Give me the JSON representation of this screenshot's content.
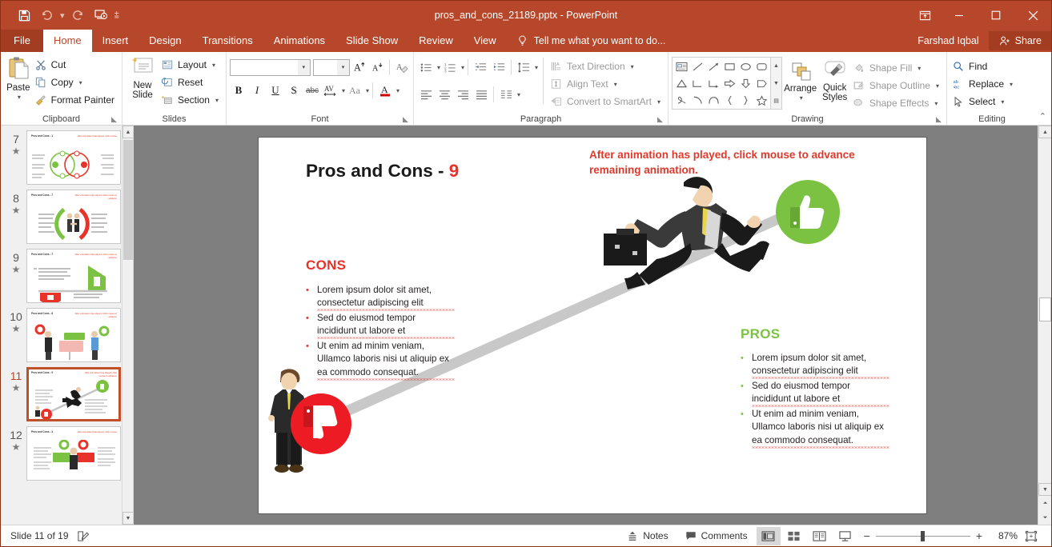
{
  "app": {
    "title": "pros_and_cons_21189.pptx - PowerPoint",
    "accent": "#b7472a"
  },
  "quick_access": {
    "save": "save-icon",
    "undo": "undo-icon",
    "redo": "redo-icon",
    "start_slideshow": "slideshow-icon",
    "customize": "customize-icon"
  },
  "window": {
    "ribbon_display": "ribbon-display-options",
    "minimize": "minimize",
    "maximize": "maximize",
    "close": "close"
  },
  "tabs": [
    {
      "label": "File",
      "active": false
    },
    {
      "label": "Home",
      "active": true
    },
    {
      "label": "Insert",
      "active": false
    },
    {
      "label": "Design",
      "active": false
    },
    {
      "label": "Transitions",
      "active": false
    },
    {
      "label": "Animations",
      "active": false
    },
    {
      "label": "Slide Show",
      "active": false
    },
    {
      "label": "Review",
      "active": false
    },
    {
      "label": "View",
      "active": false
    }
  ],
  "tellme": {
    "placeholder": "Tell me what you want to do..."
  },
  "account": {
    "user": "Farshad Iqbal",
    "share": "Share"
  },
  "ribbon": {
    "clipboard": {
      "label": "Clipboard",
      "paste": "Paste",
      "cut": "Cut",
      "copy": "Copy",
      "format_painter": "Format Painter"
    },
    "slides": {
      "label": "Slides",
      "new_slide": "New\nSlide",
      "new_slide_l1": "New",
      "new_slide_l2": "Slide",
      "layout": "Layout",
      "reset": "Reset",
      "section": "Section"
    },
    "font": {
      "label": "Font",
      "font_name": "",
      "font_name_placeholder": "",
      "font_size": "",
      "bold": "B",
      "italic": "I",
      "underline": "U",
      "shadow": "S",
      "strikethrough": "abc",
      "char_spacing": "AV",
      "change_case": "Aa",
      "font_color": "A",
      "grow_font": "A",
      "shrink_font": "A",
      "clear_formatting": "clear-formatting-icon"
    },
    "paragraph": {
      "label": "Paragraph",
      "text_direction": "Text Direction",
      "align_text": "Align Text",
      "convert_smartart": "Convert to SmartArt"
    },
    "drawing": {
      "label": "Drawing",
      "arrange": "Arrange",
      "quick_styles_l1": "Quick",
      "quick_styles_l2": "Styles",
      "shape_fill": "Shape Fill",
      "shape_outline": "Shape Outline",
      "shape_effects": "Shape Effects",
      "shapes": [
        "textbox-shape",
        "line-shape",
        "arrow-shape",
        "rectangle-shape",
        "oval-shape",
        "rounded-rectangle-shape",
        "triangle-shape",
        "elbow-connector-shape",
        "elbow-arrow-shape",
        "right-arrow-shape",
        "down-arrow-shape",
        "pentagon-shape",
        "scribble-shape",
        "arc-shape",
        "curve-shape",
        "left-brace-shape",
        "right-brace-shape",
        "star-shape"
      ]
    },
    "editing": {
      "label": "Editing",
      "find": "Find",
      "replace": "Replace",
      "select": "Select"
    },
    "collapse": "collapse-ribbon-icon"
  },
  "thumbnails": [
    {
      "number": "7",
      "selected": false,
      "title": "Pros and Cons - 1",
      "note": "After animation has played, click mouse",
      "variant": "venn"
    },
    {
      "number": "8",
      "selected": false,
      "title": "Pros and Cons - 7",
      "note": "After animation has played, click mouse to advance",
      "variant": "handshake"
    },
    {
      "number": "9",
      "selected": false,
      "title": "Pros and Cons - 7",
      "note": "After animation has played, click mouse to advance",
      "variant": "house"
    },
    {
      "number": "10",
      "selected": false,
      "title": "Pros and Cons - 8",
      "note": "After animation has played, click mouse to advance",
      "variant": "signpost"
    },
    {
      "number": "11",
      "selected": true,
      "title": "Pros and Cons - 9",
      "note": "After animation has played, click mouse to advance",
      "variant": "runner"
    },
    {
      "number": "12",
      "selected": false,
      "title": "Pros and Cons - 4",
      "note": "After animation has played, click mouse",
      "variant": "woman"
    }
  ],
  "slide": {
    "title_main": "Pros and Cons - ",
    "title_number": "9",
    "note": "After animation has played, click mouse to advance remaining animation.",
    "cons": {
      "heading": "CONS",
      "bullets": [
        "Lorem ipsum dolor sit amet, consectetur adipiscing elit",
        "Sed do eiusmod tempor incididunt ut labore et",
        "Ut enim ad minim veniam, Ullamco laboris nisi ut aliquip ex ea commodo consequat."
      ]
    },
    "pros": {
      "heading": "PROS",
      "bullets": [
        "Lorem ipsum dolor sit amet, consectetur adipiscing elit",
        "Sed do eiusmod tempor incididunt ut labore et",
        "Ut enim ad minim veniam, Ullamco laboris nisi ut aliquip ex ea commodo consequat."
      ]
    },
    "graphics": {
      "thumbs_up": "thumbs-up-icon",
      "thumbs_down": "thumbs-down-icon",
      "running_man": "running-businessman-illustration",
      "standing_man": "standing-businessman-illustration",
      "ramp": "diagonal-ramp-shape"
    },
    "colors": {
      "pros_green": "#7cc242",
      "cons_red": "#e8332a",
      "note_red": "#e0392c"
    }
  },
  "status": {
    "slide_counter": "Slide 11 of 19",
    "notes_icon": "notes-page-icon",
    "notes": "Notes",
    "comments": "Comments",
    "views": [
      {
        "name": "normal-view",
        "active": true
      },
      {
        "name": "slide-sorter-view",
        "active": false
      },
      {
        "name": "reading-view",
        "active": false
      },
      {
        "name": "slide-show-view",
        "active": false
      }
    ],
    "zoom_out": "−",
    "zoom_in": "+",
    "zoom_level": "87%",
    "fit_slide": "fit-slide-to-window-icon"
  }
}
